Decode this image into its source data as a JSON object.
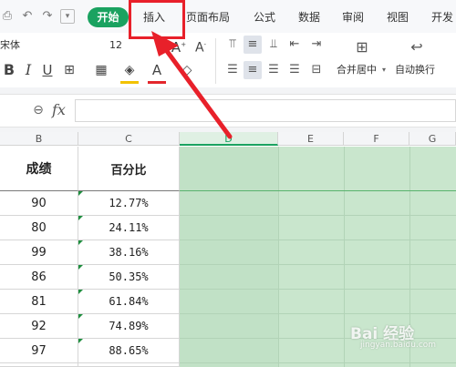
{
  "menubar": {
    "quick_access": [
      "print-preview-icon",
      "undo-icon",
      "redo-icon",
      "dropdown-icon"
    ],
    "tabs": {
      "start": "开始",
      "insert": "插入",
      "layout": "页面布局",
      "formula": "公式",
      "data": "数据",
      "review": "审阅",
      "view": "视图",
      "developer": "开发"
    },
    "active_tab_color": "#1aa260",
    "highlight_color": "#e8202a"
  },
  "ribbon": {
    "font_name": "宋体",
    "font_size": "12",
    "merge_center_label": "合并居中",
    "wrap_text_label": "自动换行",
    "font_color": "#e3262c",
    "fill_color": "#f2c200"
  },
  "formula_bar": {
    "fx_label": "fx",
    "value": ""
  },
  "grid": {
    "columns": [
      "B",
      "C",
      "D",
      "E",
      "F",
      "G"
    ],
    "selected_column": "D",
    "headers": {
      "score": "成绩",
      "percent": "百分比"
    },
    "rows": [
      {
        "score": "90",
        "percent": "12.77%"
      },
      {
        "score": "80",
        "percent": "24.11%"
      },
      {
        "score": "99",
        "percent": "38.16%"
      },
      {
        "score": "86",
        "percent": "50.35%"
      },
      {
        "score": "81",
        "percent": "61.84%"
      },
      {
        "score": "92",
        "percent": "74.89%"
      },
      {
        "score": "97",
        "percent": "88.65%"
      }
    ],
    "selection_color": "#c9e6cd"
  },
  "watermark": {
    "brand": "Bai 经验",
    "url": "jingyan.baidu.com"
  }
}
